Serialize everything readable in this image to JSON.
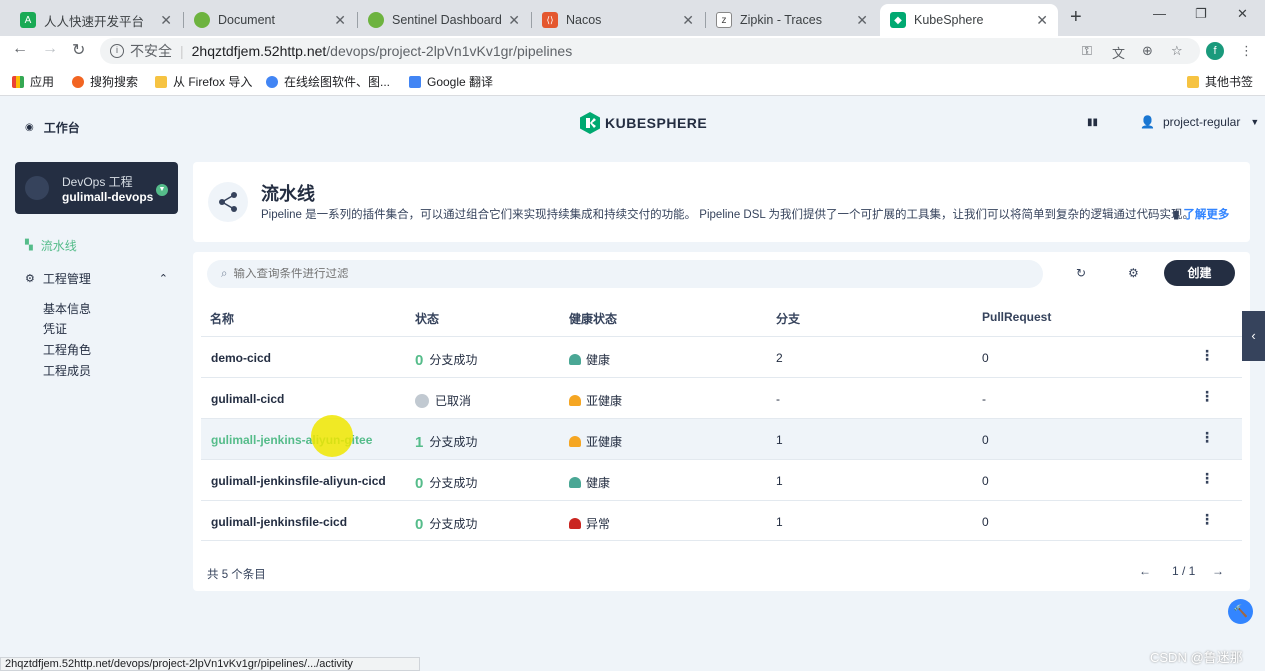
{
  "browser": {
    "tabs": [
      {
        "title": "人人快速开发平台",
        "active": false
      },
      {
        "title": "Document",
        "active": false
      },
      {
        "title": "Sentinel Dashboard",
        "active": false
      },
      {
        "title": "Nacos",
        "active": false
      },
      {
        "title": "Zipkin - Traces",
        "active": false
      },
      {
        "title": "KubeSphere",
        "active": true
      }
    ],
    "security_label": "不安全",
    "url_host": "2hqztdfjem.52http.net",
    "url_path": "/devops/project-2lpVn1vKv1gr/pipelines",
    "profile_initial": "f",
    "bookmarks": [
      "应用",
      "搜狗搜索",
      "从 Firefox 导入",
      "在线绘图软件、图...",
      "Google 翻译"
    ],
    "other_bookmarks": "其他书签",
    "status_url": "2hqztdfjem.52http.net/devops/project-2lpVn1vKv1gr/pipelines/.../activity"
  },
  "app": {
    "workbench": "工作台",
    "logo_text": "KUBESPHERE",
    "user": "project-regular"
  },
  "project": {
    "label": "DevOps 工程",
    "name": "gulimall-devops"
  },
  "sidebar": {
    "pipelines": "流水线",
    "management": "工程管理",
    "sub_items": [
      "基本信息",
      "凭证",
      "工程角色",
      "工程成员"
    ]
  },
  "header": {
    "title": "流水线",
    "description": "Pipeline 是一系列的插件集合，可以通过组合它们来实现持续集成和持续交付的功能。 Pipeline DSL 为我们提供了一个可扩展的工具集，让我们可以将简单到复杂的逻辑通过代码实现。",
    "learn_more": "了解更多"
  },
  "toolbar": {
    "search_placeholder": "输入查询条件进行过滤",
    "create_label": "创建"
  },
  "table": {
    "columns": [
      "名称",
      "状态",
      "健康状态",
      "分支",
      "PullRequest"
    ],
    "rows": [
      {
        "name": "demo-cicd",
        "status_count": "0",
        "status_text": "分支成功",
        "health": "健康",
        "health_color": "#4aa795",
        "branch": "2",
        "pr": "0"
      },
      {
        "name": "gulimall-cicd",
        "status_count": "",
        "status_text": "已取消",
        "health": "亚健康",
        "health_color": "#f5a623",
        "branch": "-",
        "pr": "-"
      },
      {
        "name": "gulimall-jenkins-aliyun-gitee",
        "status_count": "1",
        "status_text": "分支成功",
        "health": "亚健康",
        "health_color": "#f5a623",
        "branch": "1",
        "pr": "0"
      },
      {
        "name": "gulimall-jenkinsfile-aliyun-cicd",
        "status_count": "0",
        "status_text": "分支成功",
        "health": "健康",
        "health_color": "#4aa795",
        "branch": "1",
        "pr": "0"
      },
      {
        "name": "gulimall-jenkinsfile-cicd",
        "status_count": "0",
        "status_text": "分支成功",
        "health": "异常",
        "health_color": "#ca2621",
        "branch": "1",
        "pr": "0"
      }
    ],
    "total": "共 5 个条目",
    "page": "1 / 1"
  },
  "watermark": "CSDN @鲁迷那"
}
